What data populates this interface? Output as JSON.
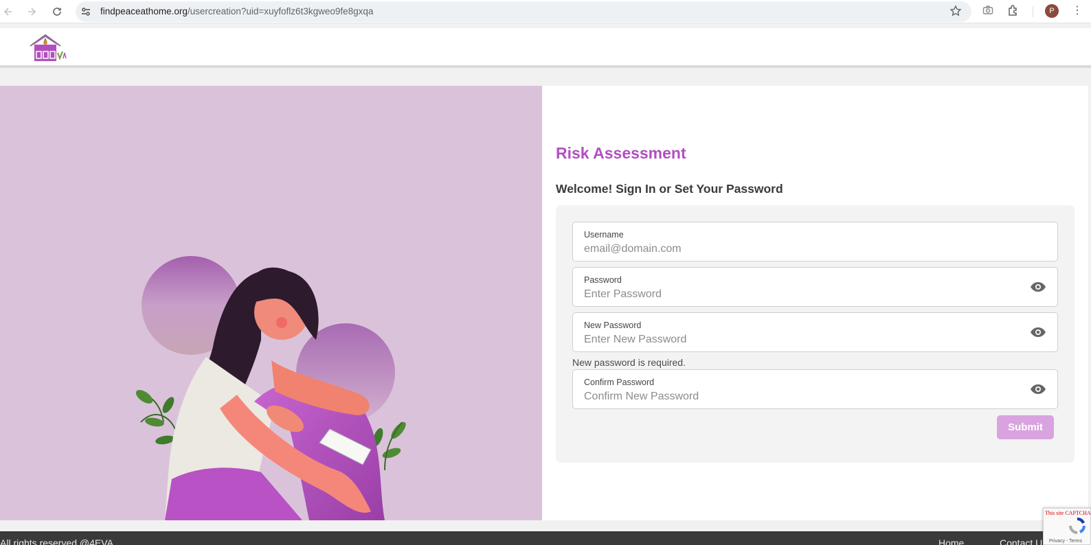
{
  "browser": {
    "url_domain": "findpeaceathome.org",
    "url_path": "/usercreation?uid=xuyfoflz6t3kgweo9fe8gxqa",
    "profile_initial": "P"
  },
  "form": {
    "title": "Risk Assessment",
    "subtitle": "Welcome! Sign In or Set Your Password",
    "username": {
      "label": "Username",
      "placeholder": "email@domain.com",
      "value": ""
    },
    "password": {
      "label": "Password",
      "placeholder": "Enter Password",
      "value": ""
    },
    "new_password": {
      "label": "New Password",
      "placeholder": "Enter New Password",
      "value": ""
    },
    "new_password_error": "New password is required.",
    "confirm_password": {
      "label": "Confirm Password",
      "placeholder": "Confirm New Password",
      "value": ""
    },
    "submit_label": "Submit"
  },
  "footer": {
    "copyright": "All rights reserved @4EVA",
    "home": "Home",
    "contact": "Contact Us"
  },
  "recaptcha": {
    "warning": "This site CAPTCHA site you a",
    "links": "Privacy - Terms"
  },
  "colors": {
    "brand_purple": "#b24fbf",
    "hero_bg": "#dac3da",
    "submit_disabled": "#d9a3df",
    "footer_bg": "#3a3a3a"
  },
  "icons": [
    "back-arrow-icon",
    "forward-arrow-icon",
    "reload-icon",
    "site-info-icon",
    "bookmark-star-icon",
    "camera-icon",
    "extensions-icon",
    "kebab-menu-icon",
    "eye-icon",
    "recaptcha-icon"
  ]
}
